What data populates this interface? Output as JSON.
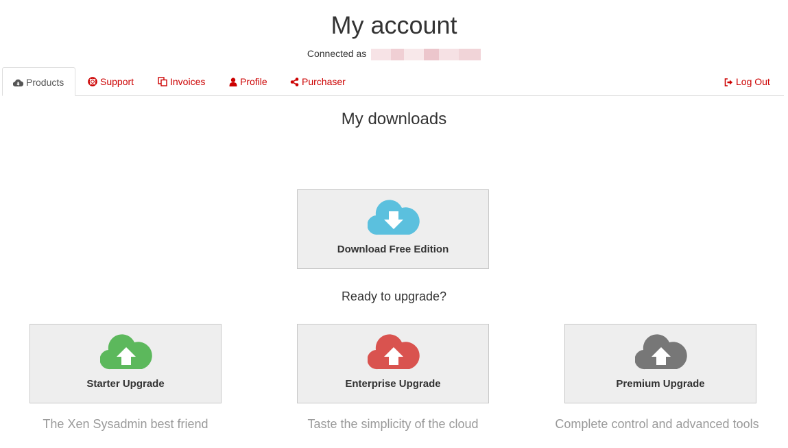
{
  "header": {
    "title": "My account",
    "connected_label": "Connected as"
  },
  "tabs": [
    {
      "label": "Products",
      "icon": "cloud-download-icon",
      "active": true
    },
    {
      "label": "Support",
      "icon": "life-ring-icon"
    },
    {
      "label": "Invoices",
      "icon": "copy-icon"
    },
    {
      "label": "Profile",
      "icon": "user-icon"
    },
    {
      "label": "Purchaser",
      "icon": "share-icon"
    },
    {
      "label": "Log Out",
      "icon": "sign-out-icon"
    }
  ],
  "main": {
    "section_title": "My downloads",
    "free_download": {
      "label": "Download Free Edition",
      "icon": "cloud-download-icon",
      "color": "#5bc0de"
    },
    "upgrade_title": "Ready to upgrade?",
    "upgrades": [
      {
        "label": "Starter Upgrade",
        "tagline": "The Xen Sysadmin best friend",
        "icon": "cloud-upload-icon",
        "color": "#5cb85c"
      },
      {
        "label": "Enterprise Upgrade",
        "tagline": "Taste the simplicity of the cloud",
        "icon": "cloud-upload-icon",
        "color": "#d9534f"
      },
      {
        "label": "Premium Upgrade",
        "tagline": "Complete control and advanced tools",
        "icon": "cloud-upload-icon",
        "color": "#777777"
      }
    ]
  },
  "colors": {
    "accent": "#cc0000",
    "card_background": "#eeeeee"
  }
}
